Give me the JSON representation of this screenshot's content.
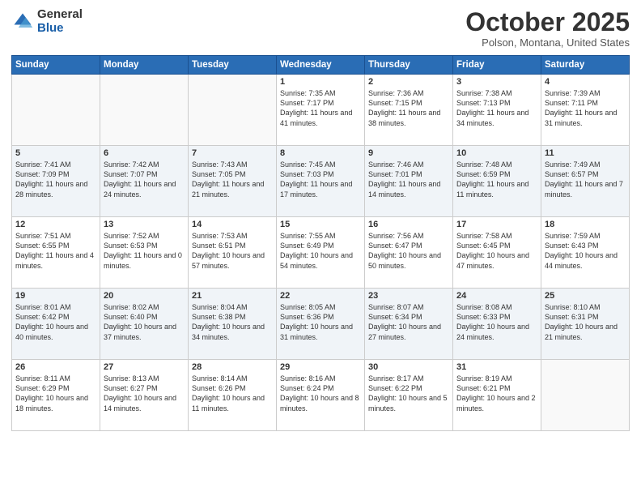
{
  "logo": {
    "general": "General",
    "blue": "Blue"
  },
  "header": {
    "month": "October 2025",
    "location": "Polson, Montana, United States"
  },
  "days_of_week": [
    "Sunday",
    "Monday",
    "Tuesday",
    "Wednesday",
    "Thursday",
    "Friday",
    "Saturday"
  ],
  "weeks": [
    [
      {
        "day": "",
        "info": ""
      },
      {
        "day": "",
        "info": ""
      },
      {
        "day": "",
        "info": ""
      },
      {
        "day": "1",
        "info": "Sunrise: 7:35 AM\nSunset: 7:17 PM\nDaylight: 11 hours\nand 41 minutes."
      },
      {
        "day": "2",
        "info": "Sunrise: 7:36 AM\nSunset: 7:15 PM\nDaylight: 11 hours\nand 38 minutes."
      },
      {
        "day": "3",
        "info": "Sunrise: 7:38 AM\nSunset: 7:13 PM\nDaylight: 11 hours\nand 34 minutes."
      },
      {
        "day": "4",
        "info": "Sunrise: 7:39 AM\nSunset: 7:11 PM\nDaylight: 11 hours\nand 31 minutes."
      }
    ],
    [
      {
        "day": "5",
        "info": "Sunrise: 7:41 AM\nSunset: 7:09 PM\nDaylight: 11 hours\nand 28 minutes."
      },
      {
        "day": "6",
        "info": "Sunrise: 7:42 AM\nSunset: 7:07 PM\nDaylight: 11 hours\nand 24 minutes."
      },
      {
        "day": "7",
        "info": "Sunrise: 7:43 AM\nSunset: 7:05 PM\nDaylight: 11 hours\nand 21 minutes."
      },
      {
        "day": "8",
        "info": "Sunrise: 7:45 AM\nSunset: 7:03 PM\nDaylight: 11 hours\nand 17 minutes."
      },
      {
        "day": "9",
        "info": "Sunrise: 7:46 AM\nSunset: 7:01 PM\nDaylight: 11 hours\nand 14 minutes."
      },
      {
        "day": "10",
        "info": "Sunrise: 7:48 AM\nSunset: 6:59 PM\nDaylight: 11 hours\nand 11 minutes."
      },
      {
        "day": "11",
        "info": "Sunrise: 7:49 AM\nSunset: 6:57 PM\nDaylight: 11 hours\nand 7 minutes."
      }
    ],
    [
      {
        "day": "12",
        "info": "Sunrise: 7:51 AM\nSunset: 6:55 PM\nDaylight: 11 hours\nand 4 minutes."
      },
      {
        "day": "13",
        "info": "Sunrise: 7:52 AM\nSunset: 6:53 PM\nDaylight: 11 hours\nand 0 minutes."
      },
      {
        "day": "14",
        "info": "Sunrise: 7:53 AM\nSunset: 6:51 PM\nDaylight: 10 hours\nand 57 minutes."
      },
      {
        "day": "15",
        "info": "Sunrise: 7:55 AM\nSunset: 6:49 PM\nDaylight: 10 hours\nand 54 minutes."
      },
      {
        "day": "16",
        "info": "Sunrise: 7:56 AM\nSunset: 6:47 PM\nDaylight: 10 hours\nand 50 minutes."
      },
      {
        "day": "17",
        "info": "Sunrise: 7:58 AM\nSunset: 6:45 PM\nDaylight: 10 hours\nand 47 minutes."
      },
      {
        "day": "18",
        "info": "Sunrise: 7:59 AM\nSunset: 6:43 PM\nDaylight: 10 hours\nand 44 minutes."
      }
    ],
    [
      {
        "day": "19",
        "info": "Sunrise: 8:01 AM\nSunset: 6:42 PM\nDaylight: 10 hours\nand 40 minutes."
      },
      {
        "day": "20",
        "info": "Sunrise: 8:02 AM\nSunset: 6:40 PM\nDaylight: 10 hours\nand 37 minutes."
      },
      {
        "day": "21",
        "info": "Sunrise: 8:04 AM\nSunset: 6:38 PM\nDaylight: 10 hours\nand 34 minutes."
      },
      {
        "day": "22",
        "info": "Sunrise: 8:05 AM\nSunset: 6:36 PM\nDaylight: 10 hours\nand 31 minutes."
      },
      {
        "day": "23",
        "info": "Sunrise: 8:07 AM\nSunset: 6:34 PM\nDaylight: 10 hours\nand 27 minutes."
      },
      {
        "day": "24",
        "info": "Sunrise: 8:08 AM\nSunset: 6:33 PM\nDaylight: 10 hours\nand 24 minutes."
      },
      {
        "day": "25",
        "info": "Sunrise: 8:10 AM\nSunset: 6:31 PM\nDaylight: 10 hours\nand 21 minutes."
      }
    ],
    [
      {
        "day": "26",
        "info": "Sunrise: 8:11 AM\nSunset: 6:29 PM\nDaylight: 10 hours\nand 18 minutes."
      },
      {
        "day": "27",
        "info": "Sunrise: 8:13 AM\nSunset: 6:27 PM\nDaylight: 10 hours\nand 14 minutes."
      },
      {
        "day": "28",
        "info": "Sunrise: 8:14 AM\nSunset: 6:26 PM\nDaylight: 10 hours\nand 11 minutes."
      },
      {
        "day": "29",
        "info": "Sunrise: 8:16 AM\nSunset: 6:24 PM\nDaylight: 10 hours\nand 8 minutes."
      },
      {
        "day": "30",
        "info": "Sunrise: 8:17 AM\nSunset: 6:22 PM\nDaylight: 10 hours\nand 5 minutes."
      },
      {
        "day": "31",
        "info": "Sunrise: 8:19 AM\nSunset: 6:21 PM\nDaylight: 10 hours\nand 2 minutes."
      },
      {
        "day": "",
        "info": ""
      }
    ]
  ]
}
